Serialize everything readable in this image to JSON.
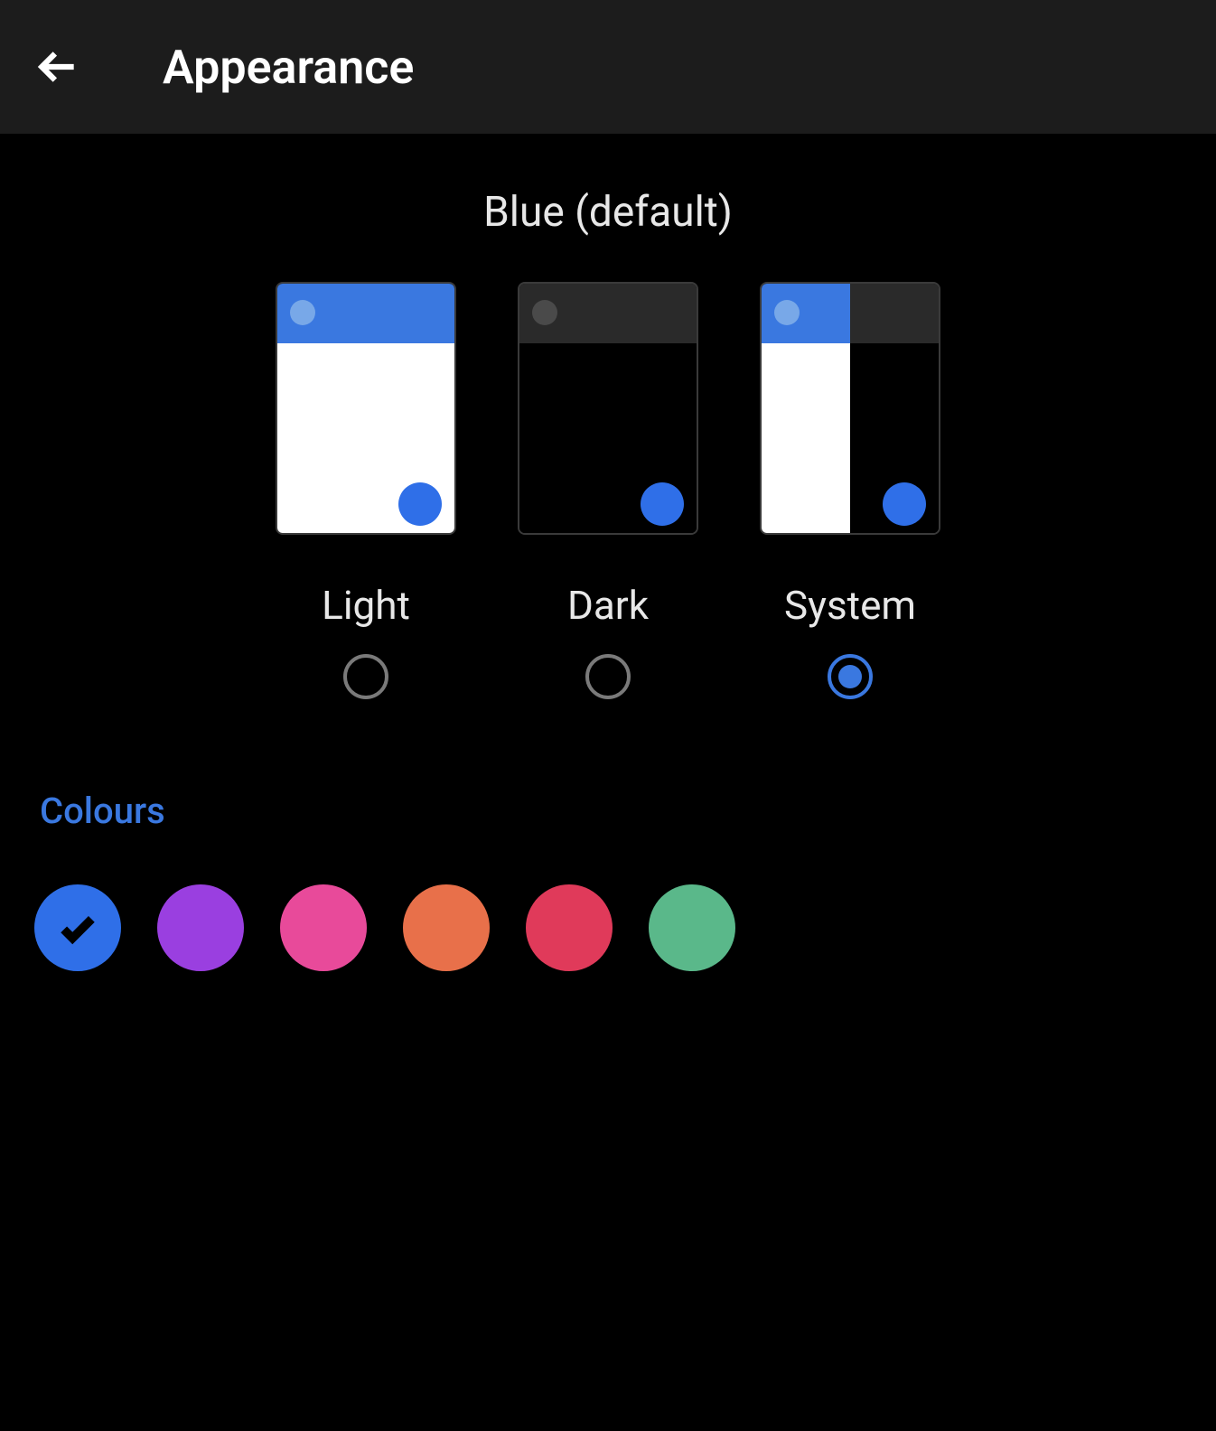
{
  "header": {
    "title": "Appearance"
  },
  "theme": {
    "current_name": "Blue (default)",
    "options": [
      {
        "label": "Light",
        "selected": false
      },
      {
        "label": "Dark",
        "selected": false
      },
      {
        "label": "System",
        "selected": true
      }
    ]
  },
  "colours_section": {
    "label": "Colours",
    "swatches": [
      {
        "name": "blue",
        "hex": "#2f6fe8",
        "selected": true
      },
      {
        "name": "purple",
        "hex": "#9a3fe0",
        "selected": false
      },
      {
        "name": "magenta",
        "hex": "#e84a9a",
        "selected": false
      },
      {
        "name": "orange",
        "hex": "#e8704a",
        "selected": false
      },
      {
        "name": "red",
        "hex": "#e03a5a",
        "selected": false
      },
      {
        "name": "green",
        "hex": "#5ab88a",
        "selected": false
      }
    ]
  },
  "accent_color": "#3a78e0"
}
